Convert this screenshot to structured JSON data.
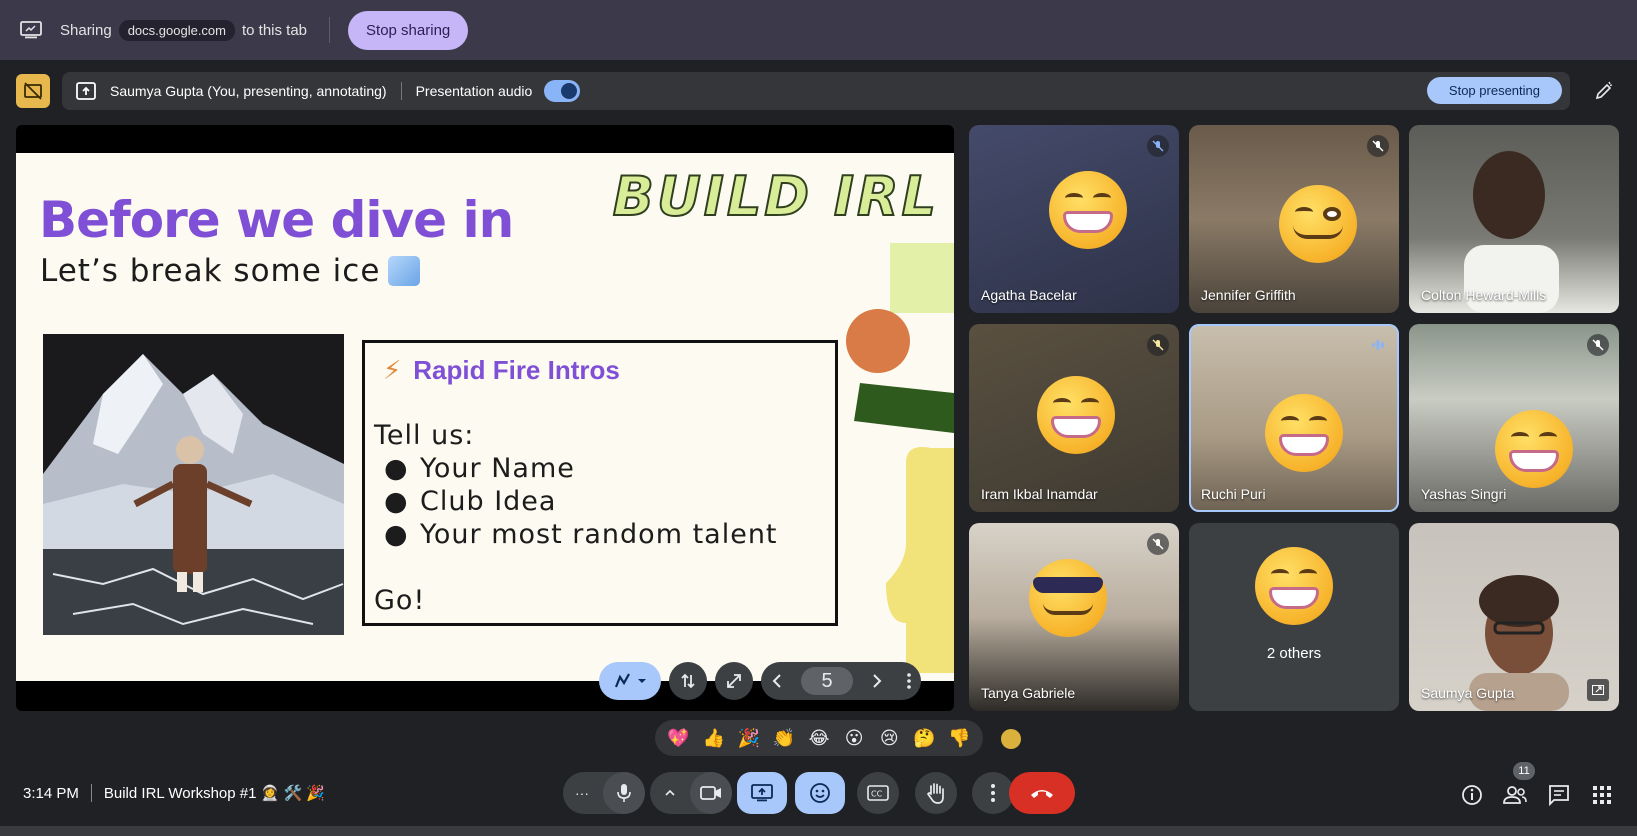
{
  "share_bar": {
    "sharing_label": "Sharing",
    "domain": "docs.google.com",
    "suffix": "to this tab",
    "stop_label": "Stop sharing"
  },
  "presenting_bar": {
    "presenter": "Saumya Gupta (You, presenting, annotating)",
    "audio_label": "Presentation audio",
    "audio_on": true,
    "stop_label": "Stop presenting"
  },
  "slide": {
    "title": "Before we dive in",
    "subtitle": "Let’s break some ice",
    "logo_text": "BUILD IRL",
    "box_title": "Rapid Fire Intros",
    "intro": "Tell us:",
    "bullets": [
      "Your Name",
      "Club Idea",
      "Your most random talent"
    ],
    "closing": "Go!",
    "page": "5",
    "colors": {
      "title": "#7f4fd6",
      "background": "#fdfbf1",
      "accent_orange": "#d97b46",
      "accent_green": "#2f5a1e",
      "accent_yellow": "#f2e27a"
    }
  },
  "participants": [
    {
      "name": "Agatha Bacelar",
      "muted": true,
      "emoji": "grin"
    },
    {
      "name": "Jennifer Griffith",
      "muted": true,
      "emoji": "wink"
    },
    {
      "name": "Colton Heward-Mills",
      "muted": false,
      "emoji": ""
    },
    {
      "name": "Iram Ikbal Inamdar",
      "muted": true,
      "emoji": "grin"
    },
    {
      "name": "Ruchi Puri",
      "muted": false,
      "speaking": true,
      "emoji": "grin"
    },
    {
      "name": "Yashas Singri",
      "muted": true,
      "emoji": "grin"
    },
    {
      "name": "Tanya Gabriele",
      "muted": true,
      "emoji": "sunglasses"
    },
    {
      "name": "2 others",
      "muted": false,
      "emoji": "grin"
    },
    {
      "name": "Saumya Gupta",
      "muted": false,
      "emoji": ""
    }
  ],
  "reactions": [
    "💖",
    "👍",
    "🎉",
    "👏",
    "😂",
    "😮",
    "😢",
    "🤔",
    "👎"
  ],
  "meeting": {
    "time": "3:14 PM",
    "title": "Build IRL Workshop #1 👩‍🚀 🛠️ 🎉",
    "people_count": "11"
  },
  "icons": {
    "more_options": "more-vert-icon",
    "mic": "mic-icon",
    "camera": "camera-icon",
    "present": "present-screen-icon",
    "emoji": "emoji-icon",
    "captions": "captions-icon",
    "raise_hand": "hand-icon",
    "end_call": "end-call-icon",
    "info": "info-icon",
    "people": "people-icon",
    "chat": "chat-icon",
    "activities": "apps-grid-icon"
  }
}
